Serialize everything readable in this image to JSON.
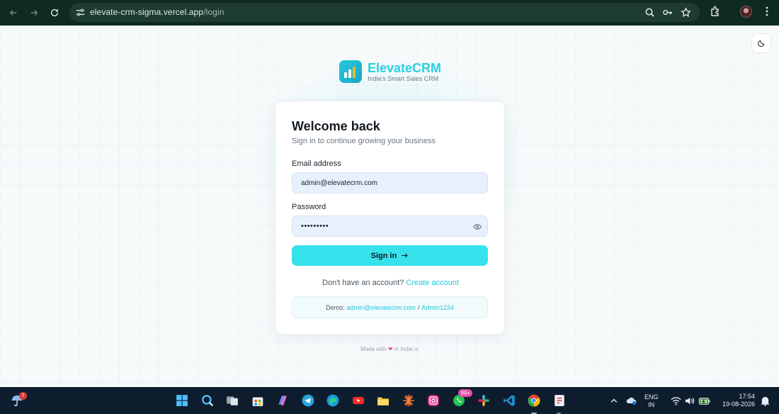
{
  "browser": {
    "url_host": "elevate-crm-sigma.vercel.app",
    "url_path": "/login"
  },
  "brand": {
    "name": "ElevateCRM",
    "tagline": "India's Smart Sales CRM"
  },
  "login": {
    "title": "Welcome back",
    "subtitle": "Sign in to continue growing your business",
    "email_label": "Email address",
    "email_value": "admin@elevatecrm.com",
    "password_label": "Password",
    "password_value": "•••••••••",
    "signin_label": "Sign in",
    "no_account_text": "Don't have an account?",
    "create_account_label": "Create account",
    "demo_prefix": "Demo:",
    "demo_email": "admin@elevatecrm.com",
    "demo_separator": "/",
    "demo_password": "Admin1234"
  },
  "footer": {
    "made_with": "Made with",
    "in_india": "in India",
    "flag": "IN"
  },
  "taskbar": {
    "weather_badge": "7",
    "whatsapp_badge": "99+",
    "lang_line1": "ENG",
    "lang_line2": "IN",
    "time": "17:54",
    "date": "19-08-2026"
  },
  "colors": {
    "accent": "#36e3ed",
    "brand_text": "#2ad0e2",
    "browser_bar": "#0f2a23",
    "taskbar": "#0e1d2e"
  }
}
